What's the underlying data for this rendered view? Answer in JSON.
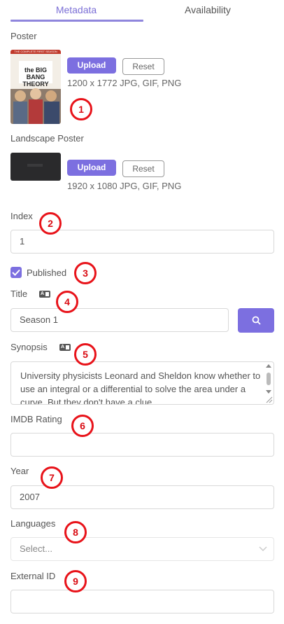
{
  "tabs": [
    {
      "label": "Metadata"
    },
    {
      "label": "Availability"
    }
  ],
  "poster": {
    "label": "Poster",
    "upload_label": "Upload",
    "reset_label": "Reset",
    "hint": "1200 x 1772 JPG, GIF, PNG",
    "image_caption": "the BIG BANG THEORY",
    "image_banner": "THE COMPLETE FIRST SEASON"
  },
  "landscape_poster": {
    "label": "Landscape Poster",
    "upload_label": "Upload",
    "reset_label": "Reset",
    "hint": "1920 x 1080 JPG, GIF, PNG"
  },
  "fields": {
    "index": {
      "label": "Index",
      "value": "1"
    },
    "published": {
      "label": "Published",
      "checked": true
    },
    "title": {
      "label": "Title",
      "value": "Season 1"
    },
    "synopsis": {
      "label": "Synopsis",
      "value": "University physicists Leonard and Sheldon know whether to use an integral or a differential to solve the area under a curve. But they don't have a clue"
    },
    "imdb_rating": {
      "label": "IMDB Rating",
      "value": ""
    },
    "year": {
      "label": "Year",
      "value": "2007"
    },
    "languages": {
      "label": "Languages",
      "placeholder": "Select..."
    },
    "external_id": {
      "label": "External ID",
      "value": ""
    }
  },
  "markers": [
    "1",
    "2",
    "3",
    "4",
    "5",
    "6",
    "7",
    "8",
    "9"
  ],
  "colors": {
    "accent": "#7c6fe0",
    "marker": "#e8131a"
  }
}
